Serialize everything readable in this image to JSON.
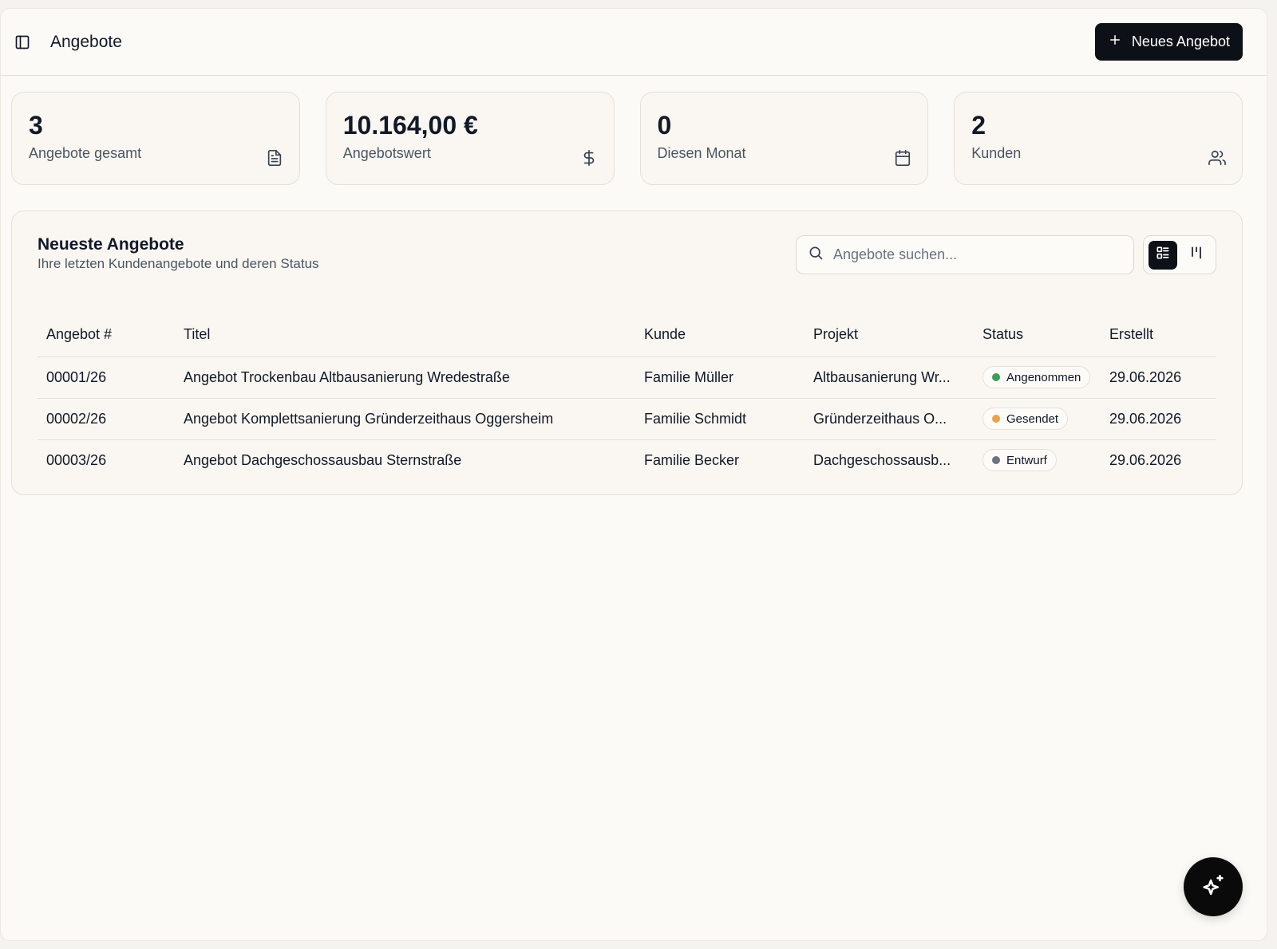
{
  "header": {
    "title": "Angebote",
    "new_button_label": "Neues Angebot"
  },
  "stats": [
    {
      "value": "3",
      "label": "Angebote gesamt",
      "icon": "file-text-icon"
    },
    {
      "value": "10.164,00 €",
      "label": "Angebotswert",
      "icon": "dollar-icon"
    },
    {
      "value": "0",
      "label": "Diesen Monat",
      "icon": "calendar-icon"
    },
    {
      "value": "2",
      "label": "Kunden",
      "icon": "users-icon"
    }
  ],
  "panel": {
    "title": "Neueste Angebote",
    "subtitle": "Ihre letzten Kundenangebote und deren Status",
    "search_placeholder": "Angebote suchen..."
  },
  "table": {
    "columns": [
      "Angebot #",
      "Titel",
      "Kunde",
      "Projekt",
      "Status",
      "Erstellt"
    ],
    "rows": [
      {
        "id": "00001/26",
        "title": "Angebot Trockenbau Altbausanierung Wredestraße",
        "kunde": "Familie Müller",
        "projekt": "Altbausanierung Wr...",
        "status": "Angenommen",
        "status_color": "#3f9c5a",
        "created": "29.06.2026"
      },
      {
        "id": "00002/26",
        "title": "Angebot Komplettsanierung Gründerzeithaus Oggersheim",
        "kunde": "Familie Schmidt",
        "projekt": "Gründerzeithaus O...",
        "status": "Gesendet",
        "status_color": "#e9a24a",
        "created": "29.06.2026"
      },
      {
        "id": "00003/26",
        "title": "Angebot Dachgeschossausbau Sternstraße",
        "kunde": "Familie Becker",
        "projekt": "Dachgeschossausb...",
        "status": "Entwurf",
        "status_color": "#6b7280",
        "created": "29.06.2026"
      }
    ]
  },
  "colors": {
    "primary": "#0d1117",
    "background": "#fcfaf6",
    "card": "#faf7f2"
  }
}
